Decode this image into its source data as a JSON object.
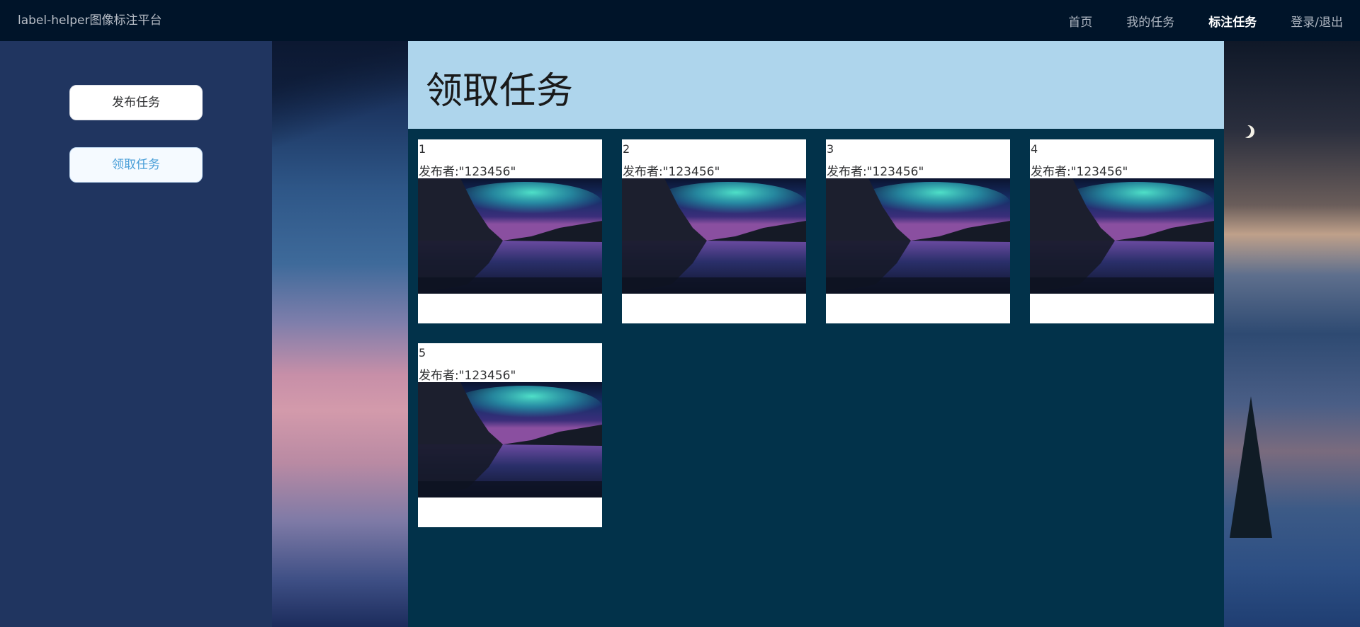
{
  "navbar": {
    "brand": "label-helper图像标注平台",
    "items": [
      {
        "label": "首页",
        "active": false
      },
      {
        "label": "我的任务",
        "active": false
      },
      {
        "label": "标注任务",
        "active": true
      },
      {
        "label": "登录/退出",
        "active": false
      }
    ]
  },
  "sidebar": {
    "publish_label": "发布任务",
    "receive_label": "领取任务"
  },
  "main": {
    "title": "领取任务",
    "publisher_prefix": "发布者:",
    "cards": [
      {
        "id": "1",
        "publisher": "\"123456\""
      },
      {
        "id": "2",
        "publisher": "\"123456\""
      },
      {
        "id": "3",
        "publisher": "\"123456\""
      },
      {
        "id": "4",
        "publisher": "\"123456\""
      },
      {
        "id": "5",
        "publisher": "\"123456\""
      }
    ]
  },
  "colors": {
    "navbar_bg": "#001429",
    "sidebar_bg": "#203560",
    "main_bg": "#02324a",
    "header_band": "#aed5ec",
    "active_accent": "#4a9fd8"
  }
}
